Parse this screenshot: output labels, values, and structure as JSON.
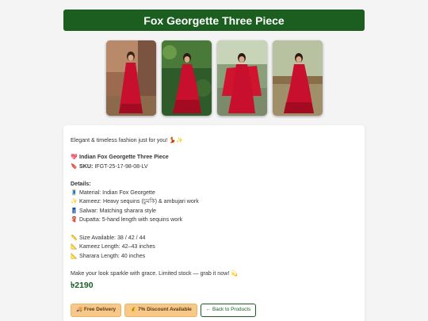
{
  "header": {
    "title": "Fox Georgette Three Piece"
  },
  "gallery": {
    "images": [
      {
        "alt": "model-photo-1"
      },
      {
        "alt": "model-photo-2"
      },
      {
        "alt": "model-photo-3"
      },
      {
        "alt": "model-photo-4"
      }
    ]
  },
  "description": {
    "tagline": "Elegant & timeless fashion just for you! 💃✨",
    "product_name": "Indian Fox Georgette Three Piece",
    "sku_label": "SKU:",
    "sku_value": "IFGT-25-17-98-08-LV",
    "details_heading": "Details:",
    "details": [
      "Material: Indian Fox Georgette",
      "Kameez: Heavy sequins (চুমকি) & ambujari work",
      "Salwar: Matching sharara style",
      "Dupatta: 5-hand length with sequins work"
    ],
    "sizes": [
      "Size Available: 38 / 42 / 44",
      "Kameez Length: 42–43 inches",
      "Sharara Length: 40 inches"
    ],
    "closing": "Make your look sparkle with grace. Limited stock — grab it now! 💫"
  },
  "price": "৳2190",
  "buttons": {
    "delivery": "Free Delivery",
    "discount": "7% Discount Available",
    "back": "← Back to Products"
  },
  "colors": {
    "brand_green": "#1b5e20",
    "badge_orange": "#f6c98a",
    "dress_red": "#c8102e"
  }
}
